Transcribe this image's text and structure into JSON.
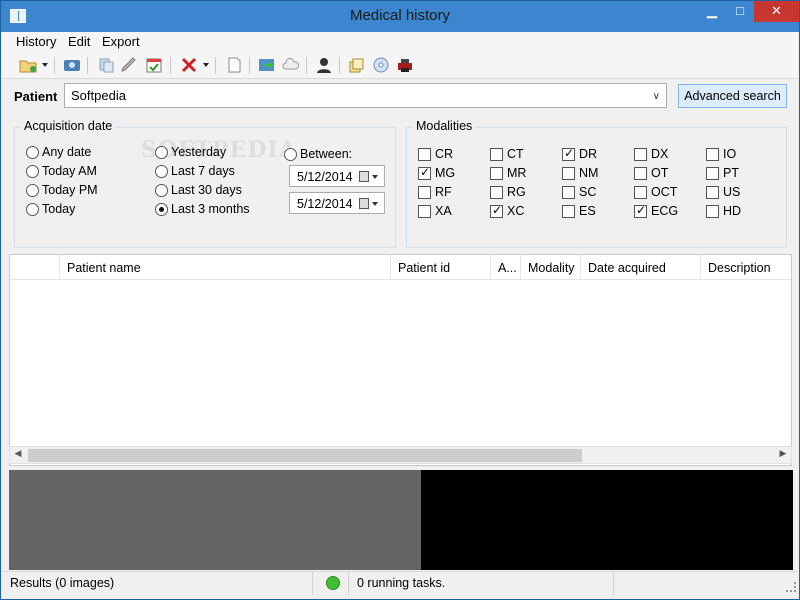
{
  "window": {
    "title": "Medical history"
  },
  "menu": [
    "History",
    "Edit",
    "Export"
  ],
  "toolbar_icons": [
    "new-folder-icon",
    "scan-icon",
    "copy-icon",
    "edit-icon",
    "calendar-icon",
    "delete-icon",
    "document-icon",
    "export-icon",
    "cloud-icon",
    "user-icon",
    "stack-icon",
    "cd-icon",
    "printer-icon"
  ],
  "patient": {
    "label": "Patient",
    "value": "Softpedia",
    "advanced_search": "Advanced search"
  },
  "acquisition": {
    "title": "Acquisition date",
    "options": [
      {
        "label": "Any date",
        "checked": false
      },
      {
        "label": "Today AM",
        "checked": false
      },
      {
        "label": "Today PM",
        "checked": false
      },
      {
        "label": "Today",
        "checked": false
      },
      {
        "label": "Yesterday",
        "checked": false
      },
      {
        "label": "Last 7 days",
        "checked": false
      },
      {
        "label": "Last 30 days",
        "checked": false
      },
      {
        "label": "Last 3 months",
        "checked": true
      },
      {
        "label": "Between:",
        "checked": false
      }
    ],
    "date_from": "5/12/2014",
    "date_to": "5/12/2014"
  },
  "modalities": {
    "title": "Modalities",
    "items": [
      {
        "label": "CR",
        "checked": false
      },
      {
        "label": "CT",
        "checked": false
      },
      {
        "label": "DR",
        "checked": true
      },
      {
        "label": "DX",
        "checked": false
      },
      {
        "label": "IO",
        "checked": false
      },
      {
        "label": "MG",
        "checked": true
      },
      {
        "label": "MR",
        "checked": false
      },
      {
        "label": "NM",
        "checked": false
      },
      {
        "label": "OT",
        "checked": false
      },
      {
        "label": "PT",
        "checked": false
      },
      {
        "label": "RF",
        "checked": false
      },
      {
        "label": "RG",
        "checked": false
      },
      {
        "label": "SC",
        "checked": false
      },
      {
        "label": "OCT",
        "checked": false
      },
      {
        "label": "US",
        "checked": false
      },
      {
        "label": "XA",
        "checked": false
      },
      {
        "label": "XC",
        "checked": true
      },
      {
        "label": "ES",
        "checked": false
      },
      {
        "label": "ECG",
        "checked": true
      },
      {
        "label": "HD",
        "checked": false
      }
    ]
  },
  "watermark": "SOFTPEDIA",
  "table": {
    "columns": [
      "",
      "Patient name",
      "Patient id",
      "A...",
      "Modality",
      "Date acquired",
      "Description"
    ]
  },
  "status": {
    "results": "Results (0 images)",
    "tasks": "0 running tasks.",
    "indicator_color": "#3fbf2f"
  }
}
